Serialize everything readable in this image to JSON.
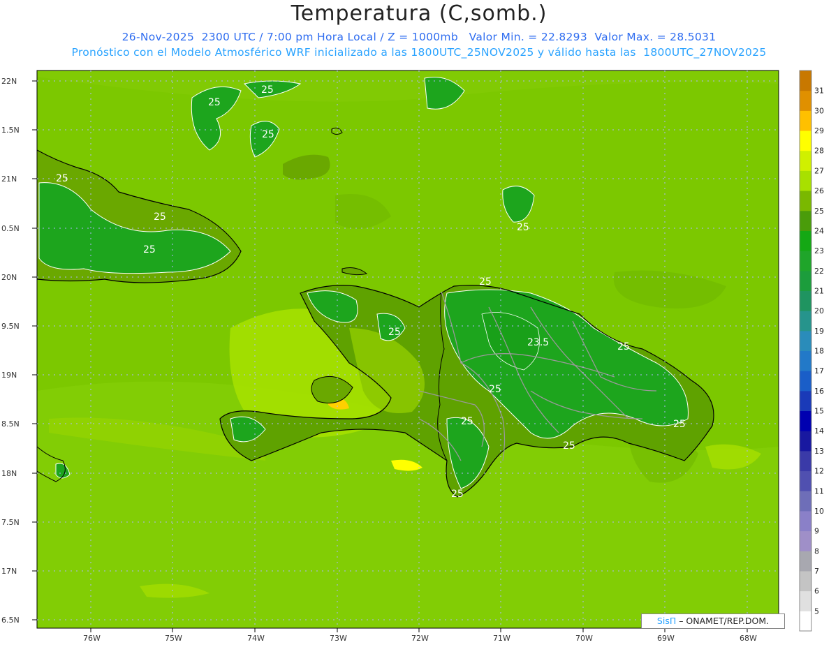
{
  "header": {
    "title": "Temperatura (C,somb.)",
    "line1": "26-Nov-2025  2300 UTC / 7:00 pm Hora Local / Z = 1000mb   Valor Min. = 22.8293  Valor Max. = 28.5031",
    "line2": "Pronóstico con el Modelo Atmosférico WRF inicializado a las 1800UTC_25NOV2025 y válido hasta las  1800UTC_27NOV2025"
  },
  "lat_labels": [
    "22N",
    "1.5N",
    "21N",
    "0.5N",
    "20N",
    "9.5N",
    "19N",
    "8.5N",
    "18N",
    "7.5N",
    "17N",
    "6.5N"
  ],
  "lon_labels": [
    "76W",
    "75W",
    "74W",
    "73W",
    "72W",
    "71W",
    "70W",
    "69W",
    "68W"
  ],
  "contour_labels": [
    "25",
    "25",
    "25",
    "25",
    "25",
    "25",
    "25",
    "25",
    "25",
    "25",
    "23.5",
    "25",
    "25",
    "25",
    "25",
    "25"
  ],
  "colorbar": {
    "levels": [
      "5",
      "6",
      "7",
      "8",
      "9",
      "10",
      "11",
      "12",
      "13",
      "14",
      "15",
      "16",
      "17",
      "18",
      "19",
      "20",
      "21",
      "22",
      "23",
      "24",
      "25",
      "26",
      "27",
      "28",
      "29",
      "30",
      "31"
    ],
    "colors": [
      "#ffffff",
      "#e0e0e0",
      "#c4c4c4",
      "#a8a8b0",
      "#9f8fc8",
      "#8a80c8",
      "#6e6eb8",
      "#5050b0",
      "#3a3aa8",
      "#1818a0",
      "#0000b0",
      "#1a3ab8",
      "#1a5ec8",
      "#2279c8",
      "#2a8cba",
      "#26948c",
      "#1f9460",
      "#1c9d3c",
      "#1fa52a",
      "#14a814",
      "#4a9c0a",
      "#7ab800",
      "#a8e000",
      "#d0f000",
      "#ffff00",
      "#ffc000",
      "#e09000",
      "#c87800"
    ]
  },
  "credit": {
    "brand": "SisΠ",
    "rest": " – ONAMET/REP.DOM."
  }
}
